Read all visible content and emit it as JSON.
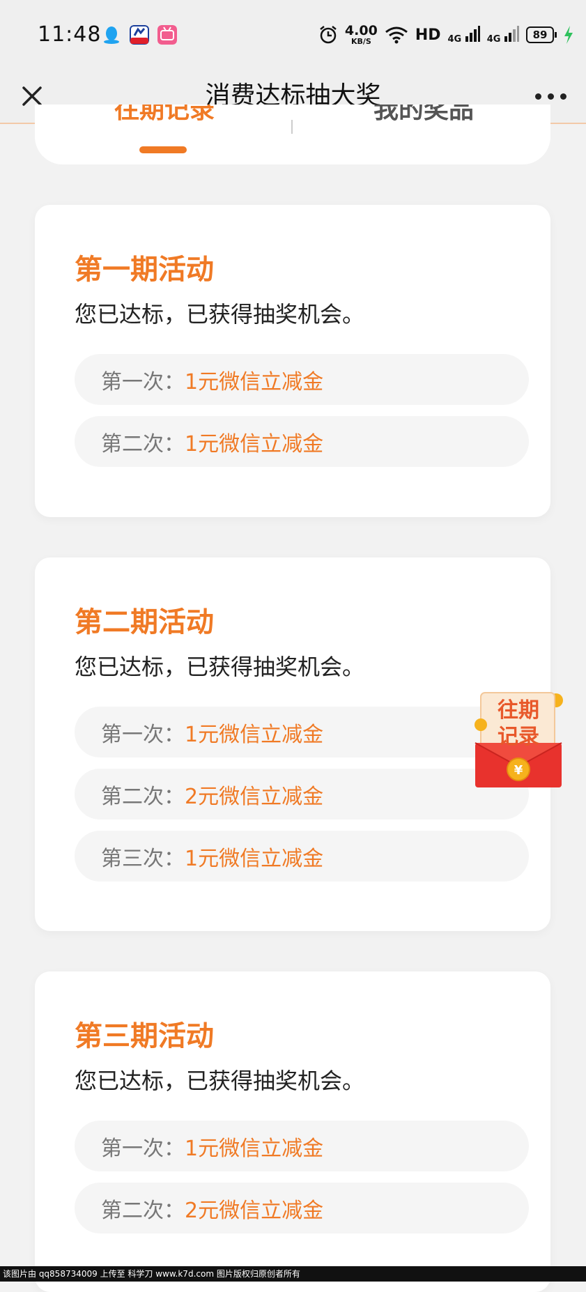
{
  "status_bar": {
    "time": "11:48",
    "app_icons": [
      "qq-penguin-icon",
      "app-15-4-icon",
      "bilibili-icon"
    ],
    "net_speed_value": "4.00",
    "net_speed_unit": "KB/S",
    "hd_label": "HD",
    "signal_1": "4G",
    "signal_2": "4G",
    "battery_level": "89",
    "icons": [
      "alarm-icon",
      "wifi-icon",
      "signal-icon",
      "battery-icon",
      "charging-icon"
    ]
  },
  "nav": {
    "title": "消费达标抽大奖",
    "close_icon": "close-icon",
    "more_icon": "more-icon"
  },
  "tabs": [
    {
      "label": "往期记录",
      "active": true
    },
    {
      "label": "我的奖品",
      "active": false
    }
  ],
  "periods": [
    {
      "title": "第一期活动",
      "status": "您已达标，已获得抽奖机会。",
      "prizes": [
        {
          "label": "第一次：",
          "value": "1元微信立减金"
        },
        {
          "label": "第二次：",
          "value": "1元微信立减金"
        }
      ]
    },
    {
      "title": "第二期活动",
      "status": "您已达标，已获得抽奖机会。",
      "prizes": [
        {
          "label": "第一次：",
          "value": "1元微信立减金"
        },
        {
          "label": "第二次：",
          "value": "2元微信立减金"
        },
        {
          "label": "第三次：",
          "value": "1元微信立减金"
        }
      ]
    },
    {
      "title": "第三期活动",
      "status": "您已达标，已获得抽奖机会。",
      "prizes": [
        {
          "label": "第一次：",
          "value": "1元微信立减金"
        },
        {
          "label": "第二次：",
          "value": "2元微信立减金"
        }
      ]
    }
  ],
  "float_widget": {
    "line1": "往期",
    "line2": "记录",
    "icon": "red-envelope-icon"
  },
  "footer": {
    "text": "该图片由 qq858734009 上传至 科学刀 www.k7d.com 图片版权归原创者所有"
  },
  "colors": {
    "accent": "#f07a25",
    "background": "#f2f2f2",
    "card": "#ffffff",
    "row": "#f5f5f5"
  }
}
